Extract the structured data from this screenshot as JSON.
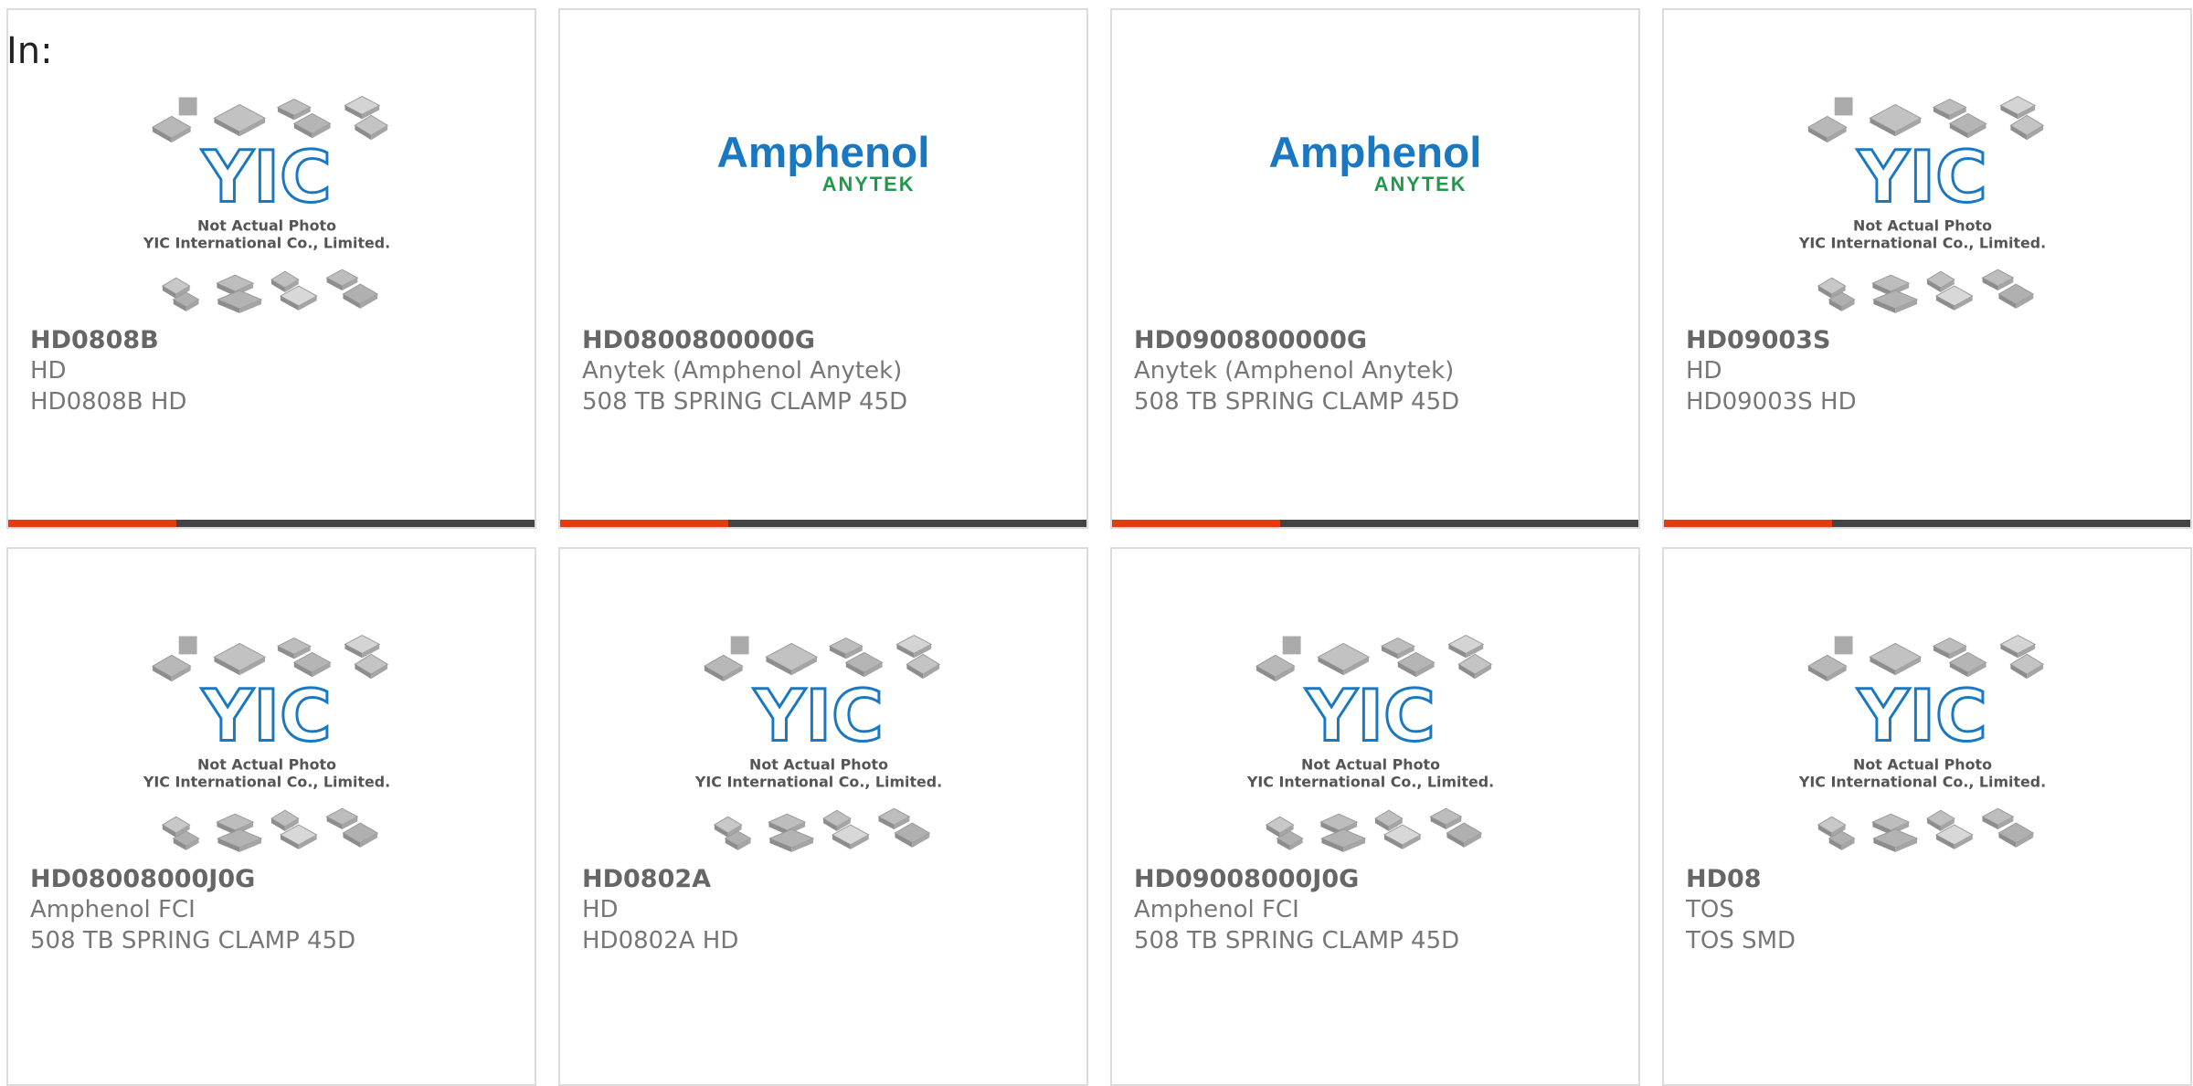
{
  "header": {
    "label": "In:"
  },
  "colors": {
    "accent": "#e83a12",
    "bar_dark": "#444444",
    "logo_blue": "#1a78c2",
    "logo_green": "#1e9a4a"
  },
  "placeholder": {
    "line1": "Not Actual Photo",
    "line2": "YIC International Co., Limited.",
    "logo": "YIC"
  },
  "amphenol": {
    "top": "Amphenol",
    "bottom": "ANYTEK"
  },
  "products": [
    {
      "part": "HD0808B",
      "manufacturer": "HD",
      "description": "HD0808B HD",
      "image": "placeholder"
    },
    {
      "part": "HD0800800000G",
      "manufacturer": "Anytek (Amphenol Anytek)",
      "description": "508 TB SPRING CLAMP 45D",
      "image": "amphenol-logo"
    },
    {
      "part": "HD0900800000G",
      "manufacturer": "Anytek (Amphenol Anytek)",
      "description": "508 TB SPRING CLAMP 45D",
      "image": "amphenol-logo"
    },
    {
      "part": "HD09003S",
      "manufacturer": "HD",
      "description": "HD09003S HD",
      "image": "placeholder"
    },
    {
      "part": "HD08008000J0G",
      "manufacturer": "Amphenol FCI",
      "description": "508 TB SPRING CLAMP 45D",
      "image": "placeholder"
    },
    {
      "part": "HD0802A",
      "manufacturer": "HD",
      "description": "HD0802A HD",
      "image": "placeholder"
    },
    {
      "part": "HD09008000J0G",
      "manufacturer": "Amphenol FCI",
      "description": "508 TB SPRING CLAMP 45D",
      "image": "placeholder"
    },
    {
      "part": "HD08",
      "manufacturer": "TOS",
      "description": "TOS SMD",
      "image": "placeholder"
    }
  ]
}
